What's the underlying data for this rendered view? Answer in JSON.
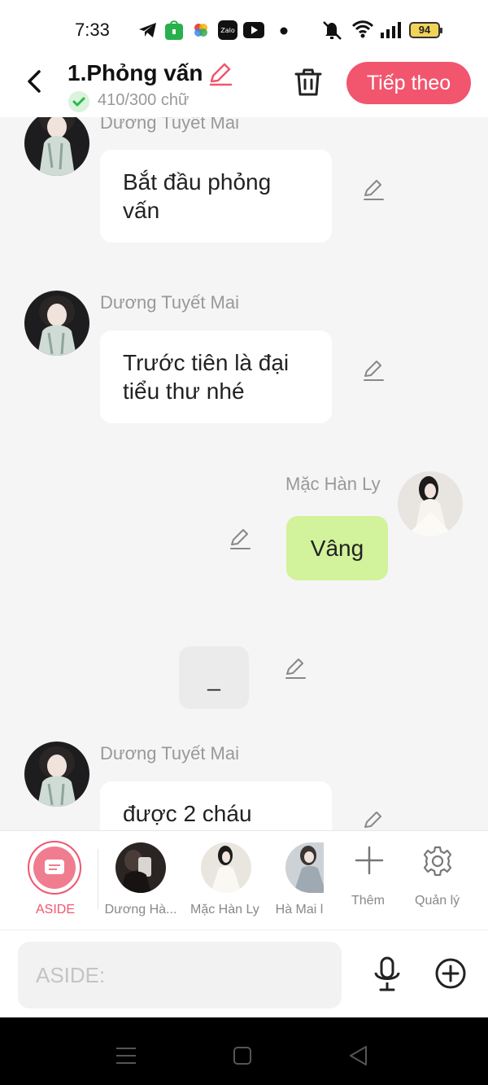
{
  "status_bar": {
    "time": "7:33",
    "battery": "94",
    "icons": [
      "telegram-icon",
      "shopee-icon",
      "photos-icon",
      "zalo-icon",
      "youtube-icon",
      "dot-icon",
      "mute-icon",
      "wifi-icon",
      "signal-icon"
    ]
  },
  "header": {
    "title": "1.Phỏng vấn",
    "word_count": "410/300 chữ",
    "next_label": "Tiếp theo"
  },
  "messages": [
    {
      "sender": "Dương Tuyết Mai",
      "text": "Bắt đầu phỏng vấn",
      "side": "left"
    },
    {
      "sender": "Dương Tuyết Mai",
      "text": "Trước tiên là đại tiểu thư nhé",
      "side": "left"
    },
    {
      "sender": "Mặc Hàn Ly",
      "text": "Vâng",
      "side": "right"
    },
    {
      "sender": "",
      "text": "_",
      "side": "center"
    },
    {
      "sender": "Dương Tuyết Mai",
      "text": "được 2 cháu",
      "side": "left"
    }
  ],
  "characters": [
    {
      "label": "ASIDE",
      "selected": true
    },
    {
      "label": "Dương Hà..."
    },
    {
      "label": "Mặc Hàn Ly"
    },
    {
      "label": "Hà Mai l"
    },
    {
      "label": "Thêm"
    },
    {
      "label": "Quản lý"
    }
  ],
  "input": {
    "placeholder": "ASIDE:"
  },
  "colors": {
    "accent": "#f2556e",
    "bubble_self": "#d2f29b",
    "bubble_other": "#ffffff",
    "background": "#f5f5f5"
  }
}
